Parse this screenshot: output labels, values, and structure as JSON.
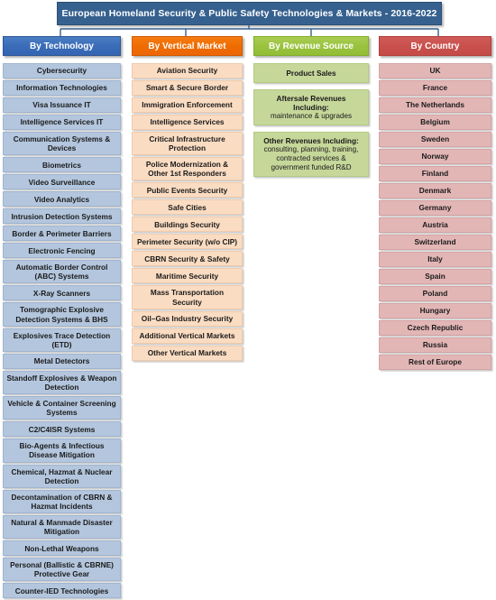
{
  "title": "European Homeland Security & Public Safety Technologies & Markets - 2016-2022",
  "colors": {
    "title_bar": "#36618f",
    "technology": "#3465b3",
    "vertical_market": "#ec6608",
    "revenue_source": "#93bd36",
    "country": "#c44b47",
    "technology_cell": "#b3c6dd",
    "vertical_cell": "#fadcc2",
    "revenue_cell": "#c6d79a",
    "country_cell": "#e3b6b6"
  },
  "columns": [
    {
      "header": "By Technology",
      "items": [
        "Cybersecurity",
        "Information Technologies",
        "Visa Issuance IT",
        "Intelligence Services IT",
        "Communication Systems & Devices",
        "Biometrics",
        "Video Surveillance",
        "Video Analytics",
        "Intrusion Detection Systems",
        "Border & Perimeter Barriers",
        "Electronic Fencing",
        "Automatic Border Control (ABC) Systems",
        "X-Ray Scanners",
        "Tomographic Explosive Detection Systems & BHS",
        "Explosives Trace Detection (ETD)",
        "Metal Detectors",
        "Standoff Explosives & Weapon Detection",
        "Vehicle & Container Screening Systems",
        "C2/C4ISR Systems",
        "Bio-Agents & Infectious Disease Mitigation",
        "Chemical, Hazmat & Nuclear Detection",
        "Decontamination of CBRN & Hazmat Incidents",
        "Natural & Manmade Disaster Mitigation",
        "Non-Lethal Weapons",
        "Personal (Ballistic & CBRNE) Protective Gear",
        "Counter-IED Technologies"
      ]
    },
    {
      "header": "By Vertical Market",
      "items": [
        "Aviation Security",
        "Smart & Secure Border",
        "Immigration Enforcement",
        "Intelligence Services",
        "Critical Infrastructure Protection",
        "Police Modernization & Other 1st Responders",
        "Public Events Security",
        "Safe Cities",
        "Buildings Security",
        "Perimeter Security (w/o CIP)",
        "CBRN Security & Safety",
        "Maritime Security",
        "Mass Transportation Security",
        "Oil–Gas Industry Security",
        "Additional Vertical Markets",
        "Other Vertical Markets"
      ]
    },
    {
      "header": "By Revenue Source",
      "items": [
        {
          "head": "Product Sales",
          "sub": ""
        },
        {
          "head": "Aftersale Revenues Including:",
          "sub": "maintenance & upgrades"
        },
        {
          "head": "Other Revenues Including:",
          "sub": "consulting, planning, training, contracted services & government funded R&D"
        }
      ]
    },
    {
      "header": "By Country",
      "items": [
        "UK",
        "France",
        "The Netherlands",
        "Belgium",
        "Sweden",
        "Norway",
        "Finland",
        "Denmark",
        "Germany",
        "Austria",
        "Switzerland",
        "Italy",
        "Spain",
        "Poland",
        "Hungary",
        "Czech Republic",
        "Russia",
        "Rest of Europe"
      ]
    }
  ]
}
